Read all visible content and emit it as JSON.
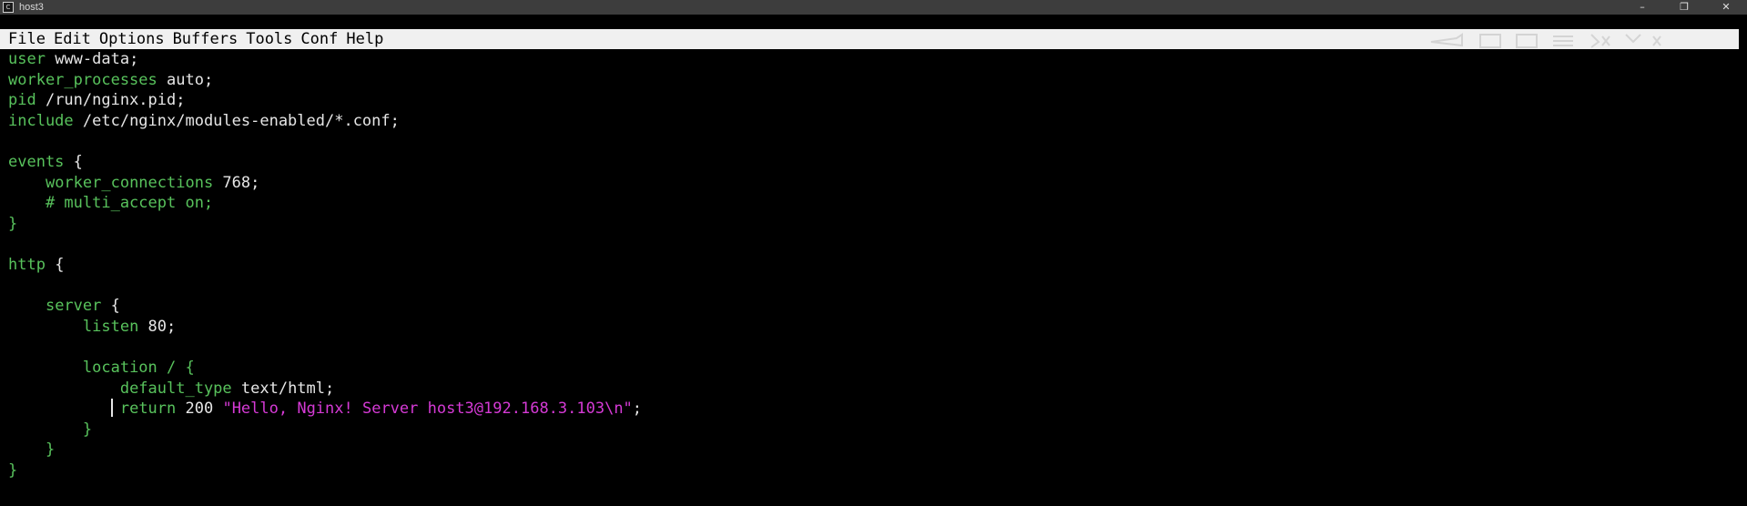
{
  "window": {
    "title": "host3",
    "controls": {
      "minimize": "–",
      "maximize": "❐",
      "close": "✕"
    }
  },
  "menubar": {
    "items": [
      "File",
      "Edit",
      "Options",
      "Buffers",
      "Tools",
      "Conf",
      "Help"
    ]
  },
  "editor": {
    "lines": [
      [
        {
          "t": "user",
          "c": "kw"
        },
        {
          "t": " www-data;",
          "c": "txt"
        }
      ],
      [
        {
          "t": "worker_processes",
          "c": "kw"
        },
        {
          "t": " auto;",
          "c": "txt"
        }
      ],
      [
        {
          "t": "pid",
          "c": "kw"
        },
        {
          "t": " /run/nginx.pid;",
          "c": "txt"
        }
      ],
      [
        {
          "t": "include",
          "c": "kw"
        },
        {
          "t": " /etc/nginx/modules-enabled/*.conf;",
          "c": "txt"
        }
      ],
      [],
      [
        {
          "t": "events",
          "c": "kw"
        },
        {
          "t": " {",
          "c": "txt"
        }
      ],
      [
        {
          "t": "    ",
          "c": "txt"
        },
        {
          "t": "worker_connections",
          "c": "kw"
        },
        {
          "t": " 768;",
          "c": "txt"
        }
      ],
      [
        {
          "t": "    # multi_accept on;",
          "c": "kw"
        }
      ],
      [
        {
          "t": "}",
          "c": "kw"
        }
      ],
      [],
      [
        {
          "t": "http",
          "c": "kw"
        },
        {
          "t": " {",
          "c": "txt"
        }
      ],
      [],
      [
        {
          "t": "    ",
          "c": "txt"
        },
        {
          "t": "server",
          "c": "kw"
        },
        {
          "t": " {",
          "c": "txt"
        }
      ],
      [
        {
          "t": "        ",
          "c": "txt"
        },
        {
          "t": "listen",
          "c": "kw"
        },
        {
          "t": " 80;",
          "c": "txt"
        }
      ],
      [],
      [
        {
          "t": "        ",
          "c": "txt"
        },
        {
          "t": "location",
          "c": "kw"
        },
        {
          "t": " / {",
          "c": "kw"
        }
      ],
      [
        {
          "t": "            ",
          "c": "txt"
        },
        {
          "t": "default_type",
          "c": "kw"
        },
        {
          "t": " text/html;",
          "c": "txt"
        }
      ],
      [
        {
          "t": "            ",
          "c": "txt",
          "cursor": true
        },
        {
          "t": "return",
          "c": "kw"
        },
        {
          "t": " 200 ",
          "c": "txt"
        },
        {
          "t": "\"Hello, Nginx! Server host3@192.168.3.103\\n\"",
          "c": "str"
        },
        {
          "t": ";",
          "c": "txt"
        }
      ],
      [
        {
          "t": "        }",
          "c": "kw"
        }
      ],
      [
        {
          "t": "    }",
          "c": "kw"
        }
      ],
      [
        {
          "t": "}",
          "c": "kw"
        }
      ]
    ]
  }
}
